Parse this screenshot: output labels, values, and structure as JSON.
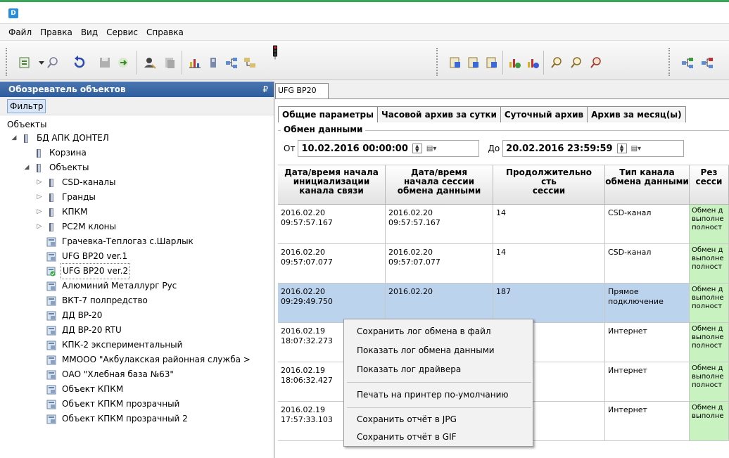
{
  "menu": [
    "Файл",
    "Правка",
    "Вид",
    "Сервис",
    "Справка"
  ],
  "left_panel": {
    "title": "Обозреватель объектов",
    "pin": "₽",
    "filter_label": "Фильтр",
    "root_label": "Объекты",
    "tree": [
      {
        "label": "БД АПК ДОНТЕЛ",
        "icon": "folder-icon"
      },
      {
        "label": "Корзина",
        "icon": "folder-icon"
      },
      {
        "label": "Объекты",
        "icon": "folder-icon"
      },
      {
        "label": "CSD-каналы",
        "icon": "folder-icon"
      },
      {
        "label": "Гранды",
        "icon": "folder-icon"
      },
      {
        "label": "КПКМ",
        "icon": "folder-icon"
      },
      {
        "label": "PC2M клоны",
        "icon": "folder-icon"
      },
      {
        "label": "Грачевка-Теплогаз с.Шарлык",
        "icon": "device-icon"
      },
      {
        "label": "UFG BP20 ver.1",
        "icon": "device-icon"
      },
      {
        "label": "UFG BP20 ver.2",
        "icon": "device-ok-icon"
      },
      {
        "label": "Алюминий Металлург Рус",
        "icon": "device-icon"
      },
      {
        "label": "ВКТ-7 полпредство",
        "icon": "device-icon"
      },
      {
        "label": "ДД BP-20",
        "icon": "device-icon"
      },
      {
        "label": "ДД BP-20 RTU",
        "icon": "device-icon"
      },
      {
        "label": "КПК-2 экспериментальный",
        "icon": "device-icon"
      },
      {
        "label": "ММООО \"Акбулакская районная служба >",
        "icon": "device-icon"
      },
      {
        "label": "ОАО \"Хлебная база №63\"",
        "icon": "device-icon"
      },
      {
        "label": "Объект КПКМ",
        "icon": "device-icon"
      },
      {
        "label": "Объект КПКМ прозрачный",
        "icon": "device-icon"
      },
      {
        "label": "Объект КПКМ прозрачный 2",
        "icon": "device-icon"
      }
    ]
  },
  "doc_tab": "UFG BP20 ver.2",
  "section_tabs": [
    "Общие параметры",
    "Часовой архив за сутки",
    "Суточный архив",
    "Архив за месяц(ы)"
  ],
  "group_title": "Обмен данными",
  "date_filter": {
    "from_label": "От",
    "from_value": "10.02.2016 00:00:00",
    "to_label": "До",
    "to_value": "20.02.2016 23:59:59"
  },
  "table": {
    "headers": [
      "Дата/время начала\nинициализации\nканала связи",
      "Дата/время\nначала сессии\nобмена данными",
      "Продолжительно\nсть\nсессии",
      "Тип канала\nобмена данными",
      "Рез\nсесси"
    ],
    "rows": [
      [
        "2016.02.20\n09:57:57.167",
        "2016.02.20\n09:57:57.167",
        "14",
        "CSD-канал",
        "Обмен д\nвыполне\nполност"
      ],
      [
        "2016.02.20\n09:57:07.077",
        "2016.02.20\n09:57:07.077",
        "14",
        "CSD-канал",
        "Обмен д\nвыполне\nполност"
      ],
      [
        "2016.02.20\n09:29:49.750",
        "2016.02.20",
        "187",
        "Прямое\nподключение",
        "Обмен д\nвыполне\nполност"
      ],
      [
        "2016.02.19\n18:07:32.273",
        "",
        "",
        "Интернет",
        "Обмен д\nвыполне\nполност"
      ],
      [
        "2016.02.19\n18:06:32.427",
        "",
        "",
        "Интернет",
        "Обмен д\nвыполне\nполност"
      ],
      [
        "2016.02.19\n17:57:33.103",
        "17:57:33.103",
        "",
        "Интернет",
        "Обмен д\nвыполне"
      ]
    ]
  },
  "context_menu": [
    "Сохранить лог обмена в файл",
    "Показать лог обмена данными",
    "Показать лог драйвера",
    "Печать на принтер по-умолчанию",
    "Сохранить отчёт в JPG",
    "Сохранить отчёт в GIF"
  ],
  "colors": {
    "accent_green": "#3aa659",
    "panel_header_blue": "#2d5d9e",
    "selected_row": "#bcd3ee",
    "result_cell_green": "#c8f2c0"
  }
}
